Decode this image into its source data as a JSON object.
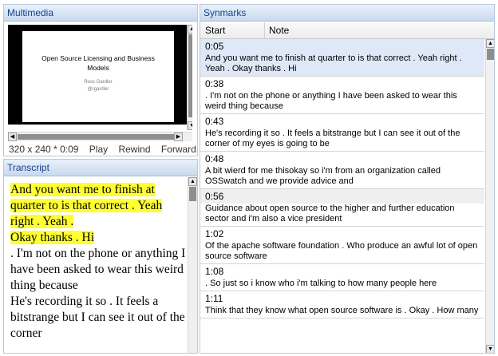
{
  "multimedia": {
    "title": "Multimedia",
    "slide": {
      "title": "Open Source Licensing and Business Models",
      "author": "Ross Gardler",
      "handle": "@rgardler"
    },
    "controls": {
      "resolution": "320 x 240",
      "separator": "*",
      "time": "0:09",
      "play": "Play",
      "rewind": "Rewind",
      "forward": "Forward"
    }
  },
  "transcript": {
    "title": "Transcript",
    "highlighted_1": "And you want me to finish at quarter to is that correct . Yeah right . Yeah .",
    "highlighted_2": "Okay thanks . Hi",
    "text_1": ". I'm not on the phone or anything I have been asked to wear this weird thing because",
    "text_2": "He's recording it so . It feels a bitstrange but I can see it out of the corner"
  },
  "synmarks": {
    "title": "Synmarks",
    "columns": [
      "Start",
      "Note"
    ],
    "rows": [
      {
        "time": "0:05",
        "note": "And you want me to finish at quarter to is that correct . Yeah right . Yeah . Okay thanks . Hi"
      },
      {
        "time": "0:38",
        "note": ". I'm not on the phone or anything I have been asked to wear this weird thing because"
      },
      {
        "time": "0:43",
        "note": "He's recording it so . It feels a bitstrange but I can see it out of the corner of my eyes is going to be"
      },
      {
        "time": "0:48",
        "note": "A bit wierd for me thisokay so i'm from an organization called OSSwatch and we provide advice and"
      },
      {
        "time": "0:56",
        "note": "Guidance about open source to the higher and further education sector and i'm also a vice president"
      },
      {
        "time": "1:02",
        "note": "Of the apache software foundation . Who produce an awful lot of open source software"
      },
      {
        "time": "1:08",
        "note": ". So just so i know who i'm talking to how many people here"
      },
      {
        "time": "1:11",
        "note": "Think that they know what open source software is . Okay . How many"
      }
    ]
  }
}
